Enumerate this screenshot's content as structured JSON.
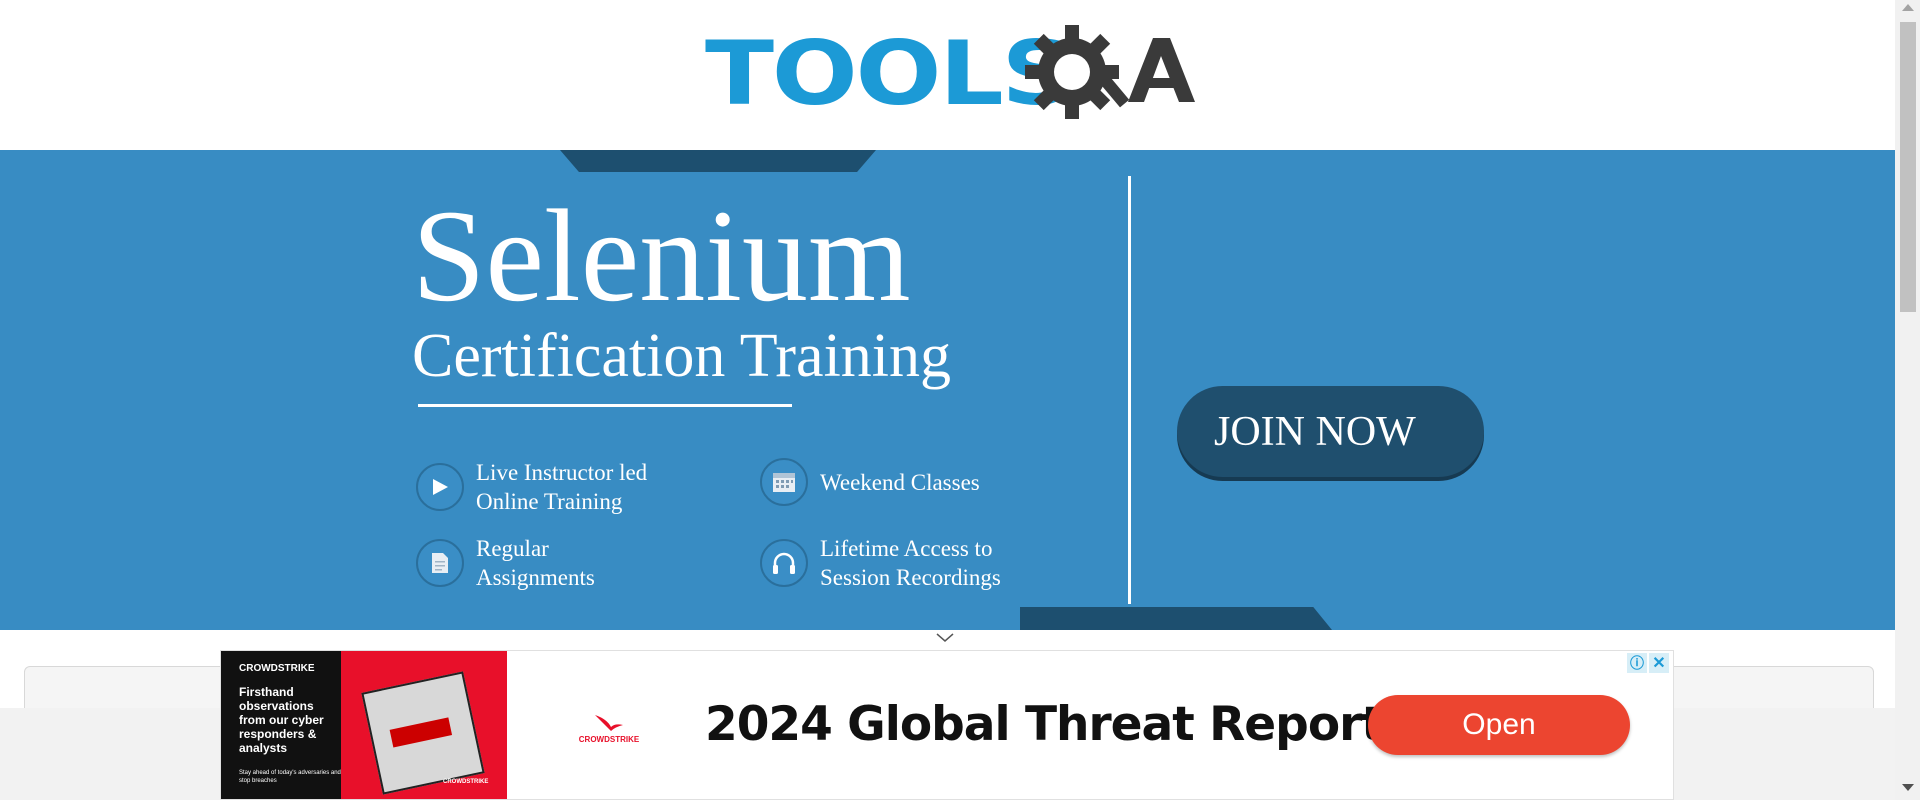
{
  "header": {
    "logo_text": "TOOLS",
    "logo_qa": "QA"
  },
  "banner": {
    "title": "Selenium",
    "subtitle": "Certification Training",
    "features": [
      {
        "text": "Live Instructor led\nOnline Training",
        "icon": "play-icon"
      },
      {
        "text": "Weekend Classes",
        "icon": "calendar-icon"
      },
      {
        "text": "Regular\nAssignments",
        "icon": "document-icon"
      },
      {
        "text": "Lifetime Access to\nSession Recordings",
        "icon": "headphones-icon"
      }
    ],
    "cta_label": "JOIN NOW",
    "colors": {
      "background": "#388cc3",
      "accent_dark": "#1d4f6f"
    }
  },
  "ad": {
    "brand": "CROWDSTRIKE",
    "image_headline": "Firsthand observations from our cyber responders & analysts",
    "image_fine_print": "Stay ahead of today's adversaries and stop breaches",
    "title": "2024 Global Threat Report",
    "open_label": "Open",
    "info_icon": "ⓘ",
    "close_icon": "✕",
    "colors": {
      "brand_red": "#e8102a",
      "open_button": "#ec4530"
    }
  }
}
